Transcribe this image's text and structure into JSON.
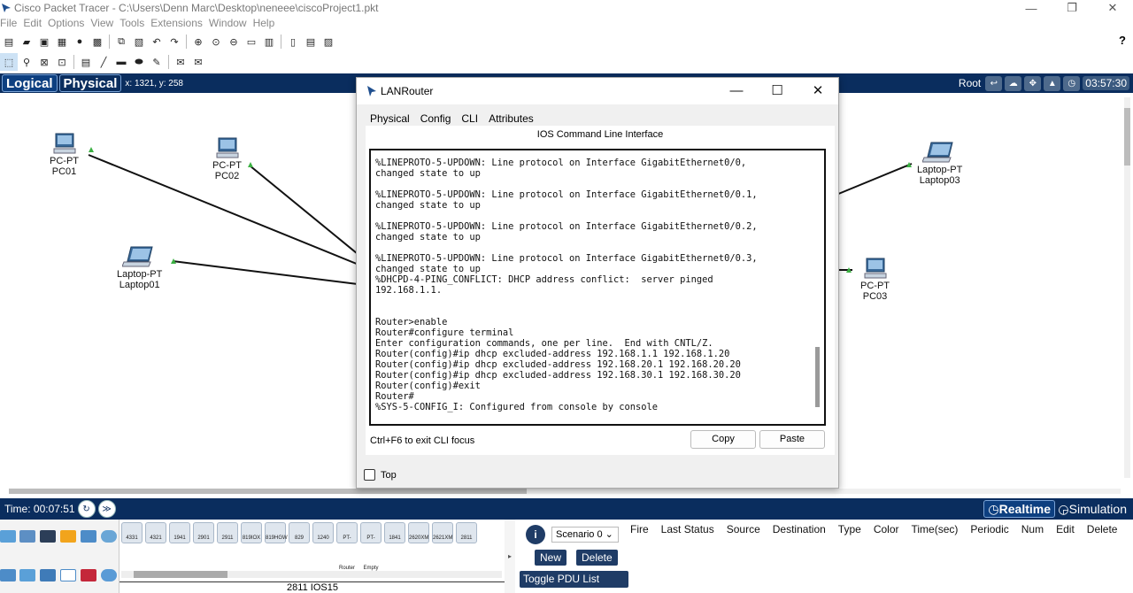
{
  "window": {
    "title": "Cisco Packet Tracer - C:\\Users\\Denn Marc\\Desktop\\neneee\\ciscoProject1.pkt",
    "controls": [
      "—",
      "❐",
      "✕"
    ]
  },
  "menu": [
    "File",
    "Edit",
    "Options",
    "View",
    "Tools",
    "Extensions",
    "Window",
    "Help"
  ],
  "toolbar_help": "?",
  "modebar": {
    "logical": "Logical",
    "physical": "Physical",
    "coords": "x: 1321, y: 258",
    "root": "Root",
    "clock": "03:57:30"
  },
  "devices": [
    {
      "type": "PC-PT",
      "name": "PC01"
    },
    {
      "type": "PC-PT",
      "name": "PC02"
    },
    {
      "type": "Laptop-PT",
      "name": "Laptop01"
    },
    {
      "type": "Laptop-PT",
      "name": "Laptop03"
    },
    {
      "type": "PC-PT",
      "name": "PC03"
    }
  ],
  "timebar": {
    "time": "Time: 00:07:51",
    "realtime": "Realtime",
    "simulation": "Simulation"
  },
  "device_models": [
    "4331",
    "4321",
    "1941",
    "2901",
    "2911",
    "819IOX",
    "819HGW",
    "829",
    "1240",
    "PT-Router",
    "PT-Empty",
    "1841",
    "2620XM",
    "2621XM",
    "2811"
  ],
  "selected_model": "2811 IOS15",
  "scenario": {
    "select": "Scenario 0",
    "new": "New",
    "delete": "Delete",
    "toggle": "Toggle PDU List Window"
  },
  "pdu_columns": [
    "Fire",
    "Last Status",
    "Source",
    "Destination",
    "Type",
    "Color",
    "Time(sec)",
    "Periodic",
    "Num",
    "Edit",
    "Delete"
  ],
  "dialog": {
    "title": "LANRouter",
    "tabs": [
      "Physical",
      "Config",
      "CLI",
      "Attributes"
    ],
    "active_tab": "CLI",
    "heading": "IOS Command Line Interface",
    "cli_output": "%LINEPROTO-5-UPDOWN: Line protocol on Interface GigabitEthernet0/0,\nchanged state to up\n\n%LINEPROTO-5-UPDOWN: Line protocol on Interface GigabitEthernet0/0.1,\nchanged state to up\n\n%LINEPROTO-5-UPDOWN: Line protocol on Interface GigabitEthernet0/0.2,\nchanged state to up\n\n%LINEPROTO-5-UPDOWN: Line protocol on Interface GigabitEthernet0/0.3,\nchanged state to up\n%DHCPD-4-PING_CONFLICT: DHCP address conflict:  server pinged\n192.168.1.1.\n\n\nRouter>enable\nRouter#configure terminal\nEnter configuration commands, one per line.  End with CNTL/Z.\nRouter(config)#ip dhcp excluded-address 192.168.1.1 192.168.1.20\nRouter(config)#ip dhcp excluded-address 192.168.20.1 192.168.20.20\nRouter(config)#ip dhcp excluded-address 192.168.30.1 192.168.30.20\nRouter(config)#exit\nRouter#\n%SYS-5-CONFIG_I: Configured from console by console",
    "hint": "Ctrl+F6 to exit CLI focus",
    "copy": "Copy",
    "paste": "Paste",
    "top_checkbox": "Top"
  },
  "colors": {
    "navy_bar": "#0a2d5e",
    "link_up": "#3cb043"
  }
}
